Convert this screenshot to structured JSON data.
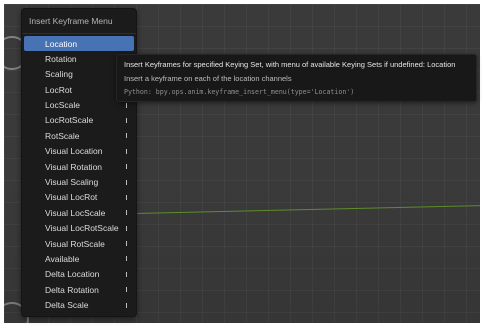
{
  "menu": {
    "title": "Insert Keyframe Menu",
    "items": [
      {
        "label": "Location",
        "active": true
      },
      {
        "label": "Rotation"
      },
      {
        "label": "Scaling"
      },
      {
        "label": "LocRot"
      },
      {
        "label": "LocScale"
      },
      {
        "label": "LocRotScale"
      },
      {
        "label": "RotScale"
      },
      {
        "label": "Visual Location"
      },
      {
        "label": "Visual Rotation"
      },
      {
        "label": "Visual Scaling"
      },
      {
        "label": "Visual LocRot"
      },
      {
        "label": "Visual LocScale"
      },
      {
        "label": "Visual LocRotScale"
      },
      {
        "label": "Visual RotScale"
      },
      {
        "label": "Available"
      },
      {
        "label": "Delta Location"
      },
      {
        "label": "Delta Rotation"
      },
      {
        "label": "Delta Scale"
      }
    ]
  },
  "tooltip": {
    "title": "Insert Keyframes for specified Keying Set, with menu of available Keying Sets if undefined: Location",
    "description": "Insert a keyframe on each of the location channels",
    "python": "Python: bpy.ops.anim.keyframe_insert_menu(type='Location')"
  },
  "colors": {
    "highlight": "#4772b3",
    "menu_background": "#1b1b1b",
    "viewport_background": "#3a3a3a",
    "x_axis": "#5e8f2c"
  },
  "icons": {
    "item_marker": "keyframe-marker-icon"
  }
}
